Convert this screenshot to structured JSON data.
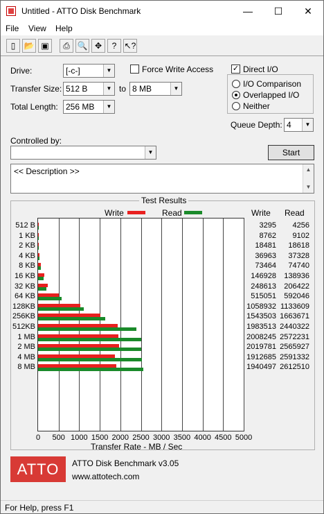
{
  "window": {
    "title": "Untitled - ATTO Disk Benchmark",
    "minimize": "—",
    "maximize": "☐",
    "close": "✕"
  },
  "menu": [
    "File",
    "View",
    "Help"
  ],
  "toolbar_icons": [
    "new-icon",
    "open-icon",
    "save-icon",
    "print-icon",
    "print-preview-icon",
    "move-icon",
    "help-icon",
    "context-help-icon"
  ],
  "form": {
    "drive_label": "Drive:",
    "drive_value": "[-c-]",
    "transfer_size_label": "Transfer Size:",
    "transfer_from": "512 B",
    "to_label": "to",
    "transfer_to": "8 MB",
    "total_length_label": "Total Length:",
    "total_length": "256 MB",
    "force_write_label": "Force Write Access",
    "direct_io_label": "Direct I/O",
    "io_comparison_label": "I/O Comparison",
    "overlapped_io_label": "Overlapped I/O",
    "neither_label": "Neither",
    "queue_depth_label": "Queue Depth:",
    "queue_depth": "4",
    "controlled_by_label": "Controlled by:",
    "controlled_by_value": "",
    "start_label": "Start",
    "description": "<< Description >>"
  },
  "results": {
    "title": "Test Results",
    "legend_write": "Write",
    "legend_read": "Read",
    "col_write": "Write",
    "col_read": "Read",
    "xlabel": "Transfer Rate - MB / Sec",
    "colors": {
      "write": "#e8201f",
      "read": "#1a8a2a"
    }
  },
  "chart_data": {
    "type": "bar",
    "orientation": "horizontal",
    "title": "Test Results",
    "xlabel": "Transfer Rate - MB / Sec",
    "xlim": [
      0,
      5000
    ],
    "xticks": [
      0,
      500,
      1000,
      1500,
      2000,
      2500,
      3000,
      3500,
      4000,
      4500,
      5000
    ],
    "categories": [
      "512 B",
      "1 KB",
      "2 KB",
      "4 KB",
      "8 KB",
      "16 KB",
      "32 KB",
      "64 KB",
      "128KB",
      "256KB",
      "512KB",
      "1 MB",
      "2 MB",
      "4 MB",
      "8 MB"
    ],
    "series": [
      {
        "name": "Write",
        "values": [
          3.2,
          8.6,
          18.0,
          36.1,
          71.7,
          143.5,
          242.8,
          502.9,
          1034.1,
          1507.3,
          1937.0,
          1961.2,
          1972.4,
          1867.9,
          1895.0
        ],
        "raw_kb": [
          3295,
          8762,
          18481,
          36963,
          73464,
          146928,
          248613,
          515051,
          1058932,
          1543503,
          1983513,
          2008245,
          2019781,
          1912685,
          1940497
        ]
      },
      {
        "name": "Read",
        "values": [
          4.2,
          8.9,
          18.2,
          36.5,
          73.0,
          135.7,
          201.6,
          578.2,
          1107.0,
          1624.7,
          2383.2,
          2512.4,
          2505.8,
          2530.6,
          2551.3
        ],
        "raw_kb": [
          4256,
          9102,
          18618,
          37328,
          74740,
          138936,
          206422,
          592046,
          1133609,
          1663671,
          2440322,
          2572231,
          2565927,
          2591332,
          2612510
        ]
      }
    ],
    "grid": true,
    "legend": "top"
  },
  "footer": {
    "logo_text": "ATTO",
    "product": "ATTO Disk Benchmark v3.05",
    "website": "www.attotech.com",
    "status": "For Help, press F1"
  }
}
